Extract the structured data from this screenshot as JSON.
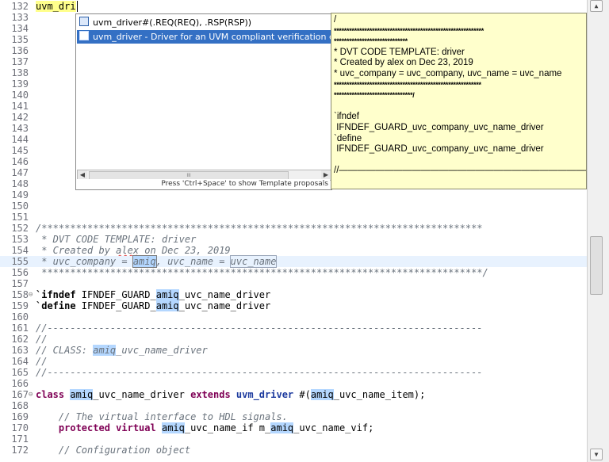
{
  "editor": {
    "lines": [
      {
        "n": "132",
        "fold": "",
        "segs": [
          {
            "t": "uvm_dri",
            "c": "typed"
          },
          {
            "t": "",
            "c": "cursor"
          }
        ],
        "bg": "typing"
      },
      {
        "n": "133",
        "fold": "",
        "segs": []
      },
      {
        "n": "134",
        "fold": "",
        "segs": []
      },
      {
        "n": "135",
        "fold": "",
        "segs": []
      },
      {
        "n": "136",
        "fold": "",
        "segs": []
      },
      {
        "n": "137",
        "fold": "",
        "segs": []
      },
      {
        "n": "138",
        "fold": "",
        "segs": []
      },
      {
        "n": "139",
        "fold": "",
        "segs": []
      },
      {
        "n": "140",
        "fold": "",
        "segs": []
      },
      {
        "n": "141",
        "fold": "",
        "segs": []
      },
      {
        "n": "142",
        "fold": "",
        "segs": []
      },
      {
        "n": "143",
        "fold": "",
        "segs": []
      },
      {
        "n": "144",
        "fold": "",
        "segs": []
      },
      {
        "n": "145",
        "fold": "",
        "segs": []
      },
      {
        "n": "146",
        "fold": "",
        "segs": []
      },
      {
        "n": "147",
        "fold": "",
        "segs": []
      },
      {
        "n": "148",
        "fold": "",
        "segs": []
      },
      {
        "n": "149",
        "fold": "",
        "segs": []
      },
      {
        "n": "150",
        "fold": "",
        "segs": []
      },
      {
        "n": "151",
        "fold": "",
        "segs": []
      },
      {
        "n": "152",
        "fold": "",
        "segs": [
          {
            "t": "/*****************************************************************************",
            "c": "cm"
          }
        ]
      },
      {
        "n": "153",
        "fold": "",
        "segs": [
          {
            "t": " * DVT CODE TEMPLATE: driver",
            "c": "cm"
          }
        ]
      },
      {
        "n": "154",
        "fold": "",
        "segs": [
          {
            "t": " * Created by ",
            "c": "cm"
          },
          {
            "t": "alex",
            "c": "cm sq"
          },
          {
            "t": " on Dec 23, 2019",
            "c": "cm"
          }
        ]
      },
      {
        "n": "155",
        "fold": "",
        "segs": [
          {
            "t": " * uvc_company = ",
            "c": "cm"
          },
          {
            "t": "amiq",
            "c": "cm hlb"
          },
          {
            "t": ", uvc_name = ",
            "c": "cm"
          },
          {
            "t": "uvc_name",
            "c": "cm hlc"
          }
        ],
        "bg": "current"
      },
      {
        "n": "156",
        "fold": "",
        "segs": [
          {
            "t": " *****************************************************************************/",
            "c": "cm"
          }
        ]
      },
      {
        "n": "157",
        "fold": "",
        "segs": []
      },
      {
        "n": "158",
        "fold": "⊖",
        "segs": [
          {
            "t": "`ifndef",
            "c": "dir"
          },
          {
            "t": " IFNDEF_GUARD_",
            "c": ""
          },
          {
            "t": "amiq",
            "c": "hl"
          },
          {
            "t": "_uvc_name_driver",
            "c": ""
          }
        ]
      },
      {
        "n": "159",
        "fold": "",
        "segs": [
          {
            "t": "`define",
            "c": "dir"
          },
          {
            "t": " IFNDEF_GUARD_",
            "c": ""
          },
          {
            "t": "amiq",
            "c": "hl"
          },
          {
            "t": "_uvc_name_driver",
            "c": ""
          }
        ]
      },
      {
        "n": "160",
        "fold": "",
        "segs": []
      },
      {
        "n": "161",
        "fold": "",
        "segs": [
          {
            "t": "//----------------------------------------------------------------------------",
            "c": "cm"
          }
        ]
      },
      {
        "n": "162",
        "fold": "",
        "segs": [
          {
            "t": "//",
            "c": "cm"
          }
        ]
      },
      {
        "n": "163",
        "fold": "",
        "segs": [
          {
            "t": "// CLASS: ",
            "c": "cm"
          },
          {
            "t": "amiq",
            "c": "cm hl"
          },
          {
            "t": "_uvc_name_driver",
            "c": "cm"
          }
        ]
      },
      {
        "n": "164",
        "fold": "",
        "segs": [
          {
            "t": "//",
            "c": "cm"
          }
        ]
      },
      {
        "n": "165",
        "fold": "",
        "segs": [
          {
            "t": "//----------------------------------------------------------------------------",
            "c": "cm"
          }
        ]
      },
      {
        "n": "166",
        "fold": "",
        "segs": []
      },
      {
        "n": "167",
        "fold": "⊖",
        "segs": [
          {
            "t": "class",
            "c": "kw"
          },
          {
            "t": " ",
            "c": ""
          },
          {
            "t": "amiq",
            "c": "hl"
          },
          {
            "t": "_uvc_name_driver ",
            "c": ""
          },
          {
            "t": "extends",
            "c": "kw"
          },
          {
            "t": " ",
            "c": ""
          },
          {
            "t": "uvm_driver",
            "c": "cls"
          },
          {
            "t": " #(",
            "c": ""
          },
          {
            "t": "amiq",
            "c": "hl"
          },
          {
            "t": "_uvc_name_item);",
            "c": ""
          }
        ]
      },
      {
        "n": "168",
        "fold": "",
        "segs": []
      },
      {
        "n": "169",
        "fold": "",
        "segs": [
          {
            "t": "    // The virtual interface to HDL signals.",
            "c": "cm"
          }
        ]
      },
      {
        "n": "170",
        "fold": "",
        "segs": [
          {
            "t": "    ",
            "c": ""
          },
          {
            "t": "protected virtual",
            "c": "kw"
          },
          {
            "t": " ",
            "c": ""
          },
          {
            "t": "amiq",
            "c": "hl"
          },
          {
            "t": "_uvc_name_if m_",
            "c": ""
          },
          {
            "t": "amiq",
            "c": "hl"
          },
          {
            "t": "_uvc_name_vif;",
            "c": ""
          }
        ]
      },
      {
        "n": "171",
        "fold": "",
        "segs": []
      },
      {
        "n": "172",
        "fold": "",
        "segs": [
          {
            "t": "    // Configuration object",
            "c": "cm"
          }
        ]
      }
    ]
  },
  "popup": {
    "items": [
      {
        "label": "uvm_driver#(.REQ(REQ), .RSP(RSP))",
        "icon": "class-icon",
        "selected": false
      },
      {
        "label": "uvm_driver - Driver for an UVM compliant verification e",
        "icon": "template-icon",
        "selected": true
      }
    ],
    "hint": "Press 'Ctrl+Space' to show Template proposals",
    "scroll_grip": "III"
  },
  "doc": {
    "lines": [
      {
        "t": "/",
        "c": ""
      },
      {
        "t": "***********************************************************",
        "c": "stars"
      },
      {
        "t": "*****************************",
        "c": "stars"
      },
      {
        "t": "* DVT CODE TEMPLATE: driver",
        "c": ""
      },
      {
        "t": "* Created by alex on Dec 23, 2019",
        "c": ""
      },
      {
        "t": "* uvc_company = uvc_company, uvc_name = uvc_name",
        "c": ""
      },
      {
        "t": "**********************************************************",
        "c": "stars"
      },
      {
        "t": "*******************************/",
        "c": "stars"
      },
      {
        "t": "",
        "c": ""
      },
      {
        "t": "`ifndef",
        "c": ""
      },
      {
        "t": " IFNDEF_GUARD_uvc_company_uvc_name_driver",
        "c": ""
      },
      {
        "t": "`define",
        "c": ""
      },
      {
        "t": " IFNDEF_GUARD_uvc_company_uvc_name_driver",
        "c": ""
      },
      {
        "t": "",
        "c": ""
      },
      {
        "t": "//———————————————————————————————",
        "c": ""
      }
    ]
  }
}
